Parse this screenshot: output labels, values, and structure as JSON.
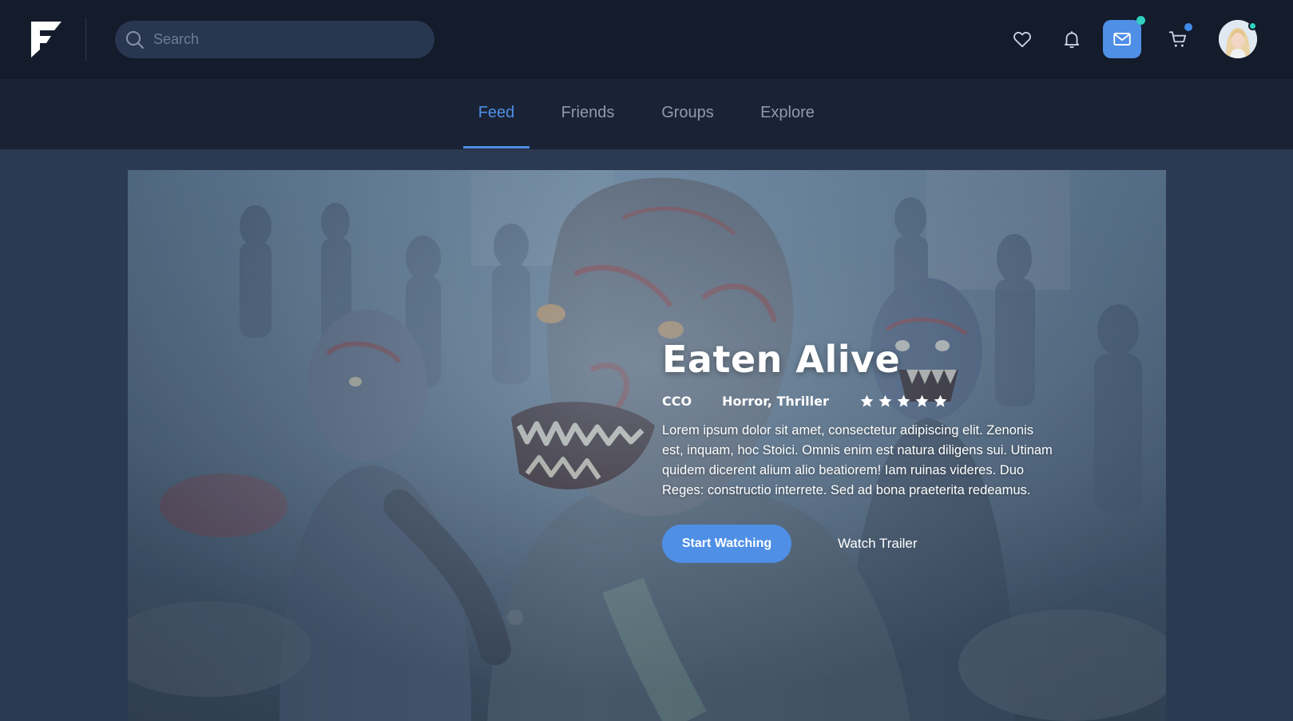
{
  "header": {
    "logo": "F",
    "search": {
      "placeholder": "Search",
      "value": ""
    },
    "icons": [
      "search-icon",
      "heart-icon",
      "bell-icon",
      "mail-icon",
      "cart-icon",
      "user-avatar"
    ],
    "badges": {
      "mail": "#2fd2c0",
      "cart": "#3f8be8",
      "avatar": "#2fd2c0"
    }
  },
  "nav": {
    "tabs": [
      {
        "label": "Feed",
        "active": true
      },
      {
        "label": "Friends",
        "active": false
      },
      {
        "label": "Groups",
        "active": false
      },
      {
        "label": "Explore",
        "active": false
      }
    ]
  },
  "hero": {
    "title": "Eaten Alive",
    "rating_label": "CCO",
    "genre": "Horror, Thriller",
    "stars": 5,
    "description": "Lorem ipsum dolor sit amet, consectetur adipiscing elit. Zenonis est, inquam, hoc Stoici. Omnis enim est natura diligens sui. Utinam quidem dicerent alium alio beatiorem! Iam ruinas videres. Duo Reges: constructio interrete. Sed ad bona praeterita redeamus.",
    "primary_button": "Start Watching",
    "secondary_button": "Watch Trailer"
  },
  "colors": {
    "accent": "#4f8fe6",
    "topbar_bg": "#141b2b",
    "nav_bg": "#1a2335",
    "page_bg": "#2b3a51",
    "tab_inactive": "#8e9ab0"
  }
}
